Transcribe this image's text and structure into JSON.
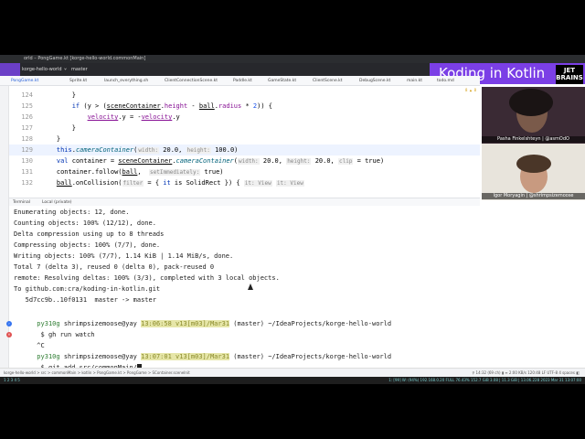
{
  "window": {
    "title": "orld – PongGame.kt [korge-hello-world.commonMain]"
  },
  "toolbar": {
    "project": "korge-hello-world",
    "branch": "master"
  },
  "brand": {
    "title": "Koding in Kotlin",
    "logo_line1": "JET",
    "logo_line2": "BRAINS"
  },
  "tabs": [
    "PongGame.kt",
    "Sprite.kt",
    "launch_everything.sh",
    "ClientConnectionScene.kt",
    "Paddle.kt",
    "GameState.kt",
    "ClientScene.kt",
    "DebugScene.kt",
    "main.kt",
    "todo.md"
  ],
  "editor": {
    "warnings": "8 ▲ 8",
    "lines": [
      {
        "num": "124",
        "parts": [
          {
            "t": "        }",
            "c": ""
          }
        ]
      },
      {
        "num": "125",
        "parts": [
          {
            "t": "        ",
            "c": ""
          },
          {
            "t": "if",
            "c": "kw"
          },
          {
            "t": " (y > (",
            "c": ""
          },
          {
            "t": "sceneContainer",
            "c": "ul"
          },
          {
            "t": ".",
            "c": ""
          },
          {
            "t": "height",
            "c": "prop"
          },
          {
            "t": " - ",
            "c": ""
          },
          {
            "t": "ball",
            "c": "ul"
          },
          {
            "t": ".",
            "c": ""
          },
          {
            "t": "radius",
            "c": "prop"
          },
          {
            "t": " * ",
            "c": ""
          },
          {
            "t": "2",
            "c": "num"
          },
          {
            "t": ")) {",
            "c": ""
          }
        ]
      },
      {
        "num": "126",
        "parts": [
          {
            "t": "            ",
            "c": ""
          },
          {
            "t": "velocity",
            "c": "ul prop"
          },
          {
            "t": ".y = -",
            "c": ""
          },
          {
            "t": "velocity",
            "c": "ul prop"
          },
          {
            "t": ".y",
            "c": ""
          }
        ]
      },
      {
        "num": "127",
        "parts": [
          {
            "t": "        }",
            "c": ""
          }
        ]
      },
      {
        "num": "128",
        "parts": [
          {
            "t": "    }",
            "c": ""
          }
        ]
      },
      {
        "num": "129",
        "parts": [
          {
            "t": "    ",
            "c": ""
          },
          {
            "t": "this",
            "c": "kw"
          },
          {
            "t": ".",
            "c": ""
          },
          {
            "t": "cameraContainer",
            "c": "fn"
          },
          {
            "t": "(",
            "c": ""
          },
          {
            "t": "width:",
            "c": "hint"
          },
          {
            "t": " 20.0, ",
            "c": ""
          },
          {
            "t": "height:",
            "c": "hint"
          },
          {
            "t": " 100.0)",
            "c": ""
          }
        ]
      },
      {
        "num": "130",
        "parts": [
          {
            "t": "    ",
            "c": ""
          },
          {
            "t": "val",
            "c": "kw"
          },
          {
            "t": " container = ",
            "c": ""
          },
          {
            "t": "sceneContainer",
            "c": "ul"
          },
          {
            "t": ".",
            "c": ""
          },
          {
            "t": "cameraContainer",
            "c": "fn"
          },
          {
            "t": "(",
            "c": ""
          },
          {
            "t": "width:",
            "c": "hint"
          },
          {
            "t": " 20.0, ",
            "c": ""
          },
          {
            "t": "height:",
            "c": "hint"
          },
          {
            "t": " 20.0, ",
            "c": ""
          },
          {
            "t": "clip",
            "c": "hint"
          },
          {
            "t": " = true)",
            "c": ""
          }
        ]
      },
      {
        "num": "131",
        "parts": [
          {
            "t": "    container.follow(",
            "c": ""
          },
          {
            "t": "ball",
            "c": "ul"
          },
          {
            "t": ",  ",
            "c": ""
          },
          {
            "t": "setImmediately:",
            "c": "hint"
          },
          {
            "t": " true)",
            "c": ""
          }
        ]
      },
      {
        "num": "132",
        "parts": [
          {
            "t": "    ",
            "c": ""
          },
          {
            "t": "ball",
            "c": "ul"
          },
          {
            "t": ".onCollision(",
            "c": ""
          },
          {
            "t": "filter",
            "c": "hint"
          },
          {
            "t": " = { ",
            "c": ""
          },
          {
            "t": "it",
            "c": "kw"
          },
          {
            "t": " is ",
            "c": ""
          },
          {
            "t": "SolidRect",
            "c": ""
          },
          {
            "t": " }) { ",
            "c": ""
          },
          {
            "t": "it: View",
            "c": "hint"
          },
          {
            "t": " ",
            "c": ""
          },
          {
            "t": "it: View",
            "c": "hint"
          }
        ]
      }
    ]
  },
  "terminal_tabs": [
    "Terminal",
    "Local (private)"
  ],
  "terminal": {
    "lines": [
      "Enumerating objects: 12, done.",
      "Counting objects: 100% (12/12), done.",
      "Delta compression using up to 8 threads",
      "Compressing objects: 100% (7/7), done.",
      "Writing objects: 100% (7/7), 1.14 KiB | 1.14 MiB/s, done.",
      "Total 7 (delta 3), reused 0 (delta 0), pack-reused 0",
      "remote: Resolving deltas: 100% (3/3), completed with 3 local objects.",
      "To github.com:cra/koding-in-kotlin.git",
      "   5d7cc9b..10f0131  master -> master"
    ],
    "prompt1": {
      "env": "py310g",
      "user": "shrimpsizemoose@yay",
      "time": "13:06:58 v13[m03]/Mar31",
      "rest": " (master) ~/IdeaProjects/korge-hello-world",
      "cmd": " $ gh run watch",
      "after": "^C"
    },
    "prompt2": {
      "env": "py310g",
      "user": "shrimpsizemoose@yay",
      "time": "13:07:01 v13[m03]/Mar31",
      "rest": " (master) ~/IdeaProjects/korge-hello-world",
      "cmd": " $ git add src/commonMain/"
    }
  },
  "status": {
    "breadcrumb": "korge-hello-world  >  src  >  commonMain  >  kotlin  >  PongGame.kt  >  PongGame  >  SContainer.sceneInit",
    "right": "⚲ 14:32 (69 ch) ▮ ≡ 2:00 KB/s   120:48   LF   UTF-8   4 spaces  ◧"
  },
  "taskbar": {
    "left": "1 2 3 4 5",
    "right": "1: [99] W: (94%) 192.168.0.20   FULL 76.43% 152.7 GiB 3.08 | 11.3 GiB | 13.06.228  2023 Mar 31 13:07:00"
  },
  "webcams": [
    {
      "name": "Pasha Finkelshteyn | @asmOdO"
    },
    {
      "name": "Igor Moryagin | @shrimpsizemoose"
    }
  ],
  "colors": {
    "brand": "#7b3fe6",
    "ide_dark": "#27282c",
    "caret_line": "#edf3ff"
  }
}
